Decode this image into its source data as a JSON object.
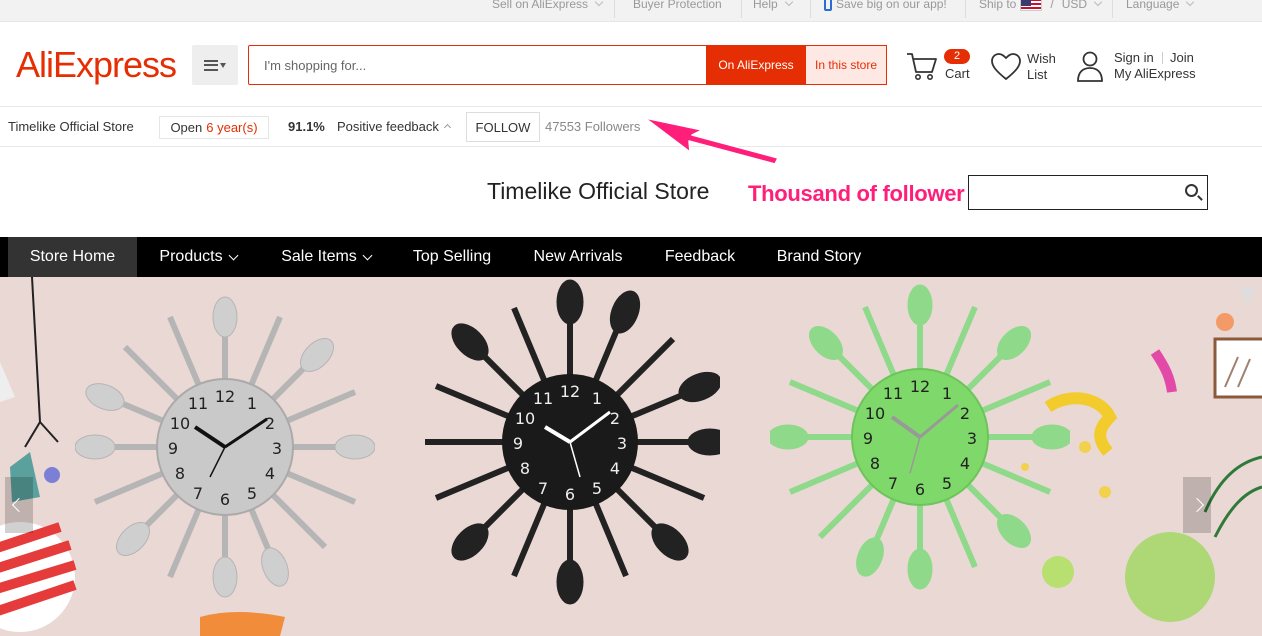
{
  "topbar": {
    "sell": "Sell on AliExpress",
    "buyer_protection": "Buyer Protection",
    "help": "Help",
    "app": "Save big on our app!",
    "ship_to": "Ship to",
    "currency_sep": "/",
    "currency": "USD",
    "language": "Language"
  },
  "header": {
    "logo": "AliExpress",
    "search_placeholder": "I'm shopping for...",
    "search_on_aliexpress": "On AliExpress",
    "search_in_store": "In this store",
    "cart_count": "2",
    "cart_label": "Cart",
    "wish_line1": "Wish",
    "wish_line2": "List",
    "sign_in": "Sign in",
    "join": "Join",
    "my_aliexpress": "My AliExpress"
  },
  "store_bar": {
    "store_name": "Timelike Official Store",
    "open_label": "Open",
    "open_years": "6 year(s)",
    "feedback_pct": "91.1%",
    "feedback_label": "Positive feedback",
    "follow": "FOLLOW",
    "followers": "47553 Followers"
  },
  "store_header": {
    "title": "Timelike Official Store",
    "annotation": "Thousand of follower"
  },
  "nav": {
    "items": [
      "Store Home",
      "Products",
      "Sale Items",
      "Top Selling",
      "New Arrivals",
      "Feedback",
      "Brand Story"
    ]
  },
  "banner": {
    "clock1_numbers": [
      "12",
      "1",
      "2",
      "3",
      "4",
      "5",
      "6",
      "7",
      "8",
      "9",
      "10",
      "11"
    ],
    "clock2_numbers": [
      "12",
      "1",
      "2",
      "3",
      "4",
      "5",
      "6",
      "7",
      "8",
      "9",
      "10",
      "11"
    ],
    "clock3_numbers": [
      "12",
      "1",
      "2",
      "3",
      "4",
      "5",
      "6",
      "7",
      "8",
      "9",
      "10",
      "11"
    ]
  },
  "colors": {
    "brand": "#e62e04",
    "annotation": "#ff1f7a",
    "nav_bg": "#000000",
    "clock_silver": "#c9c9c9",
    "clock_black": "#1a1a1a",
    "clock_green": "#8bdc6f"
  }
}
